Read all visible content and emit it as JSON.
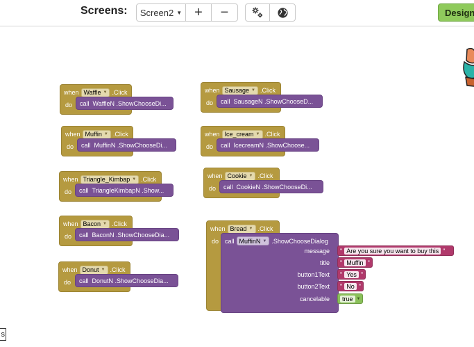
{
  "toolbar": {
    "screens_label": "Screens:",
    "screen_selected": "Screen2",
    "add_screen": "+",
    "remove_screen": "−",
    "designer_label": "Designer"
  },
  "keywords": {
    "when": "when",
    "do": "do",
    "call": "call",
    "click": ".Click"
  },
  "event_blocks": [
    {
      "component": "Waffle",
      "call_text": "WaffleN .ShowChooseDi..."
    },
    {
      "component": "Muffin",
      "call_text": "MuffinN .ShowChooseDi..."
    },
    {
      "component": "Triangle_Kimbap",
      "call_text": "TriangleKimbapN .Show..."
    },
    {
      "component": "Bacon",
      "call_text": "BaconN .ShowChooseDia..."
    },
    {
      "component": "Donut",
      "call_text": "DonutN .ShowChooseDia..."
    },
    {
      "component": "Sausage",
      "call_text": "SausageN .ShowChooseD..."
    },
    {
      "component": "Ice_cream",
      "call_text": "IcecreamN .ShowChoose..."
    },
    {
      "component": "Cookie",
      "call_text": "CookieN .ShowChooseDi..."
    }
  ],
  "bread_block": {
    "component": "Bread",
    "call_component": "MuffinN",
    "method": ".ShowChooseDialog",
    "args": {
      "message_label": "message",
      "message_value": "Are you sure you want to buy this",
      "title_label": "title",
      "title_value": "Muffin",
      "button1_label": "button1Text",
      "button1_value": "Yes",
      "button2_label": "button2Text",
      "button2_value": "No",
      "cancelable_label": "cancelable",
      "cancelable_value": "true"
    }
  },
  "corner_box_text": "s",
  "colors": {
    "event_block": "#b59a40",
    "call_block": "#7a5296",
    "text_block": "#b0396b",
    "logic_block": "#8ac05a",
    "designer_button": "#8fca5c"
  },
  "icons": [
    "gear-icon",
    "globe-icon",
    "dropdown-caret-icon",
    "mascot-icon"
  ]
}
